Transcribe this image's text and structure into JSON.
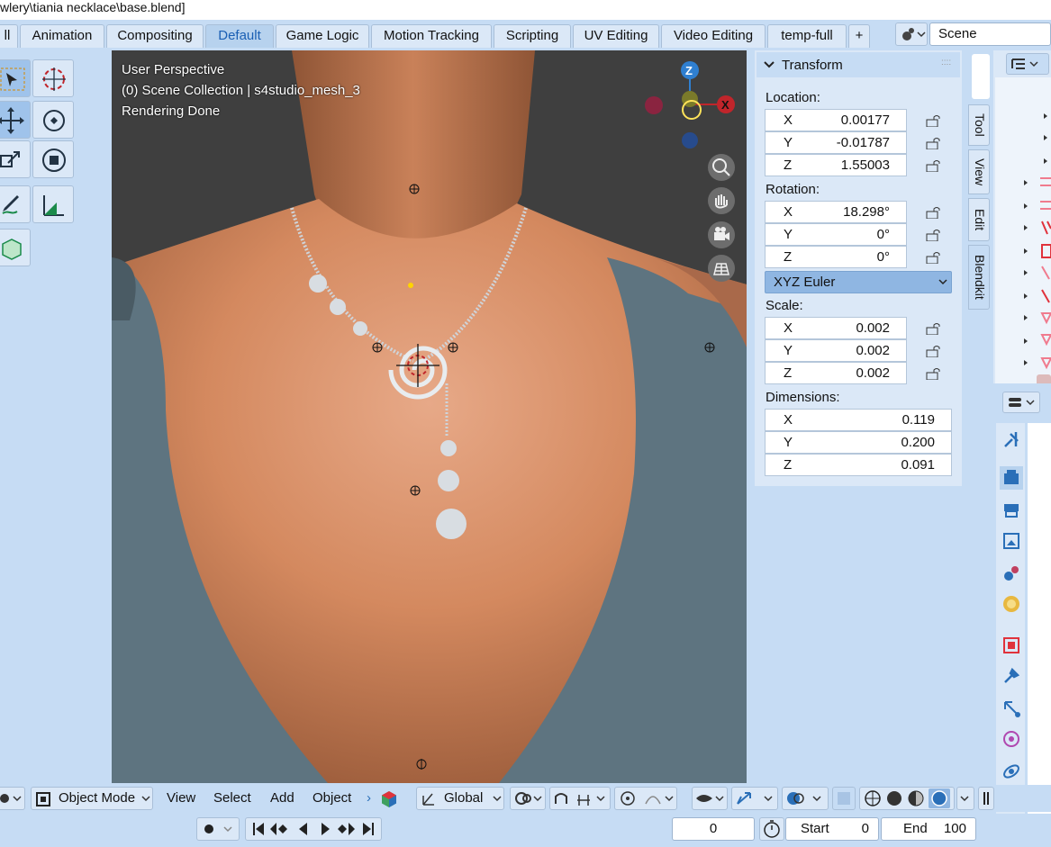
{
  "window": {
    "title": "wlery\\tiania necklace\\base.blend]"
  },
  "workspace_tabs": [
    {
      "label": "ll"
    },
    {
      "label": "Animation"
    },
    {
      "label": "Compositing"
    },
    {
      "label": "Default",
      "active": true
    },
    {
      "label": "Game Logic"
    },
    {
      "label": "Motion Tracking"
    },
    {
      "label": "Scripting"
    },
    {
      "label": "UV Editing"
    },
    {
      "label": "Video Editing"
    },
    {
      "label": "temp-full"
    },
    {
      "label": "+"
    }
  ],
  "scene": {
    "label": "Scene"
  },
  "viewport": {
    "view_name": "User Perspective",
    "collection_info": "(0) Scene Collection | s4studio_mesh_3",
    "render_status": "Rendering Done",
    "gizmo_axes": {
      "z": "Z",
      "x": "X"
    }
  },
  "npanel": {
    "tabs": [
      "Tool",
      "View",
      "Edit",
      "Blendkit"
    ],
    "transform": {
      "title": "Transform",
      "location_label": "Location:",
      "location": [
        {
          "axis": "X",
          "value": "0.00177"
        },
        {
          "axis": "Y",
          "value": "-0.01787"
        },
        {
          "axis": "Z",
          "value": "1.55003"
        }
      ],
      "rotation_label": "Rotation:",
      "rotation": [
        {
          "axis": "X",
          "value": "18.298°"
        },
        {
          "axis": "Y",
          "value": "0°"
        },
        {
          "axis": "Z",
          "value": "0°"
        }
      ],
      "rotation_mode": "XYZ Euler",
      "scale_label": "Scale:",
      "scale": [
        {
          "axis": "X",
          "value": "0.002"
        },
        {
          "axis": "Y",
          "value": "0.002"
        },
        {
          "axis": "Z",
          "value": "0.002"
        }
      ],
      "dimensions_label": "Dimensions:",
      "dimensions": [
        {
          "axis": "X",
          "value": "0.119"
        },
        {
          "axis": "Y",
          "value": "0.200"
        },
        {
          "axis": "Z",
          "value": "0.091"
        }
      ]
    }
  },
  "header": {
    "mode": "Object Mode",
    "menus": [
      "View",
      "Select",
      "Add",
      "Object"
    ],
    "orientation": "Global"
  },
  "timeline": {
    "current_frame": "0",
    "start_label": "Start",
    "start": "0",
    "end_label": "End",
    "end": "100"
  },
  "colors": {
    "accent": "#1a5fb4",
    "panel_bg": "#dbe8f7",
    "ui_bg": "#c6dcf4"
  }
}
